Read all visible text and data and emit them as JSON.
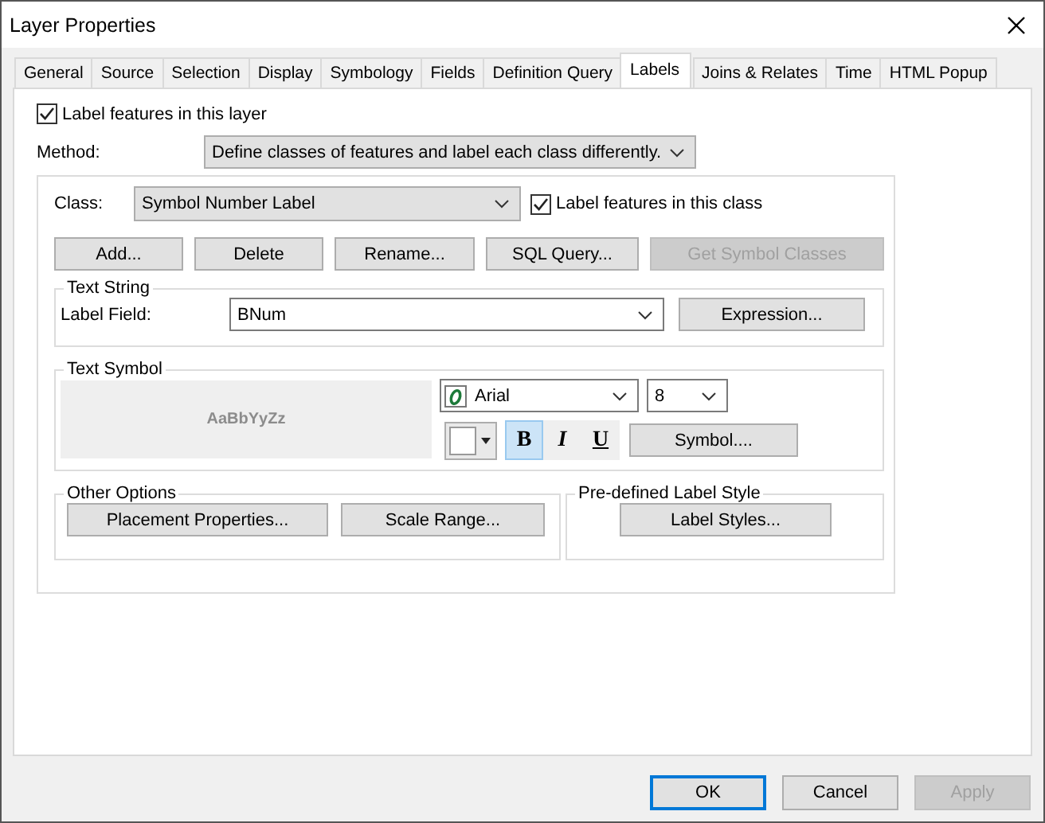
{
  "window": {
    "title": "Layer Properties"
  },
  "tabs": [
    {
      "label": "General",
      "selected": false
    },
    {
      "label": "Source",
      "selected": false
    },
    {
      "label": "Selection",
      "selected": false
    },
    {
      "label": "Display",
      "selected": false
    },
    {
      "label": "Symbology",
      "selected": false
    },
    {
      "label": "Fields",
      "selected": false
    },
    {
      "label": "Definition Query",
      "selected": false
    },
    {
      "label": "Labels",
      "selected": true
    },
    {
      "label": "Joins & Relates",
      "selected": false
    },
    {
      "label": "Time",
      "selected": false
    },
    {
      "label": "HTML Popup",
      "selected": false
    }
  ],
  "label_layer": {
    "label": "Label features in this layer",
    "checked": true
  },
  "method": {
    "label": "Method:",
    "value": "Define classes of features and label each class differently."
  },
  "class": {
    "label": "Class:",
    "value": "Symbol Number Label",
    "label_class": {
      "label": "Label features in this class",
      "checked": true
    }
  },
  "class_buttons": [
    {
      "label": "Add...",
      "disabled": false
    },
    {
      "label": "Delete",
      "disabled": false
    },
    {
      "label": "Rename...",
      "disabled": false
    },
    {
      "label": "SQL Query...",
      "disabled": false
    },
    {
      "label": "Get Symbol Classes",
      "disabled": true
    }
  ],
  "text_string": {
    "title": "Text String",
    "label": "Label Field:",
    "value": "BNum",
    "button": "Expression..."
  },
  "text_symbol": {
    "title": "Text Symbol",
    "preview": "AaBbYyZz",
    "font": "Arial",
    "size": "8",
    "styles": [
      {
        "label": "B",
        "kind": "bold",
        "selected": true
      },
      {
        "label": "I",
        "kind": "italic",
        "selected": false
      },
      {
        "label": "U",
        "kind": "underline",
        "selected": false
      }
    ],
    "button": "Symbol...."
  },
  "other_options": {
    "title": "Other Options",
    "buttons": [
      "Placement Properties...",
      "Scale Range..."
    ]
  },
  "predefined": {
    "title": "Pre-defined Label Style",
    "button": "Label Styles..."
  },
  "footer_buttons": [
    {
      "label": "OK",
      "default": true,
      "disabled": false
    },
    {
      "label": "Cancel",
      "default": false,
      "disabled": false
    },
    {
      "label": "Apply",
      "default": false,
      "disabled": true
    }
  ]
}
